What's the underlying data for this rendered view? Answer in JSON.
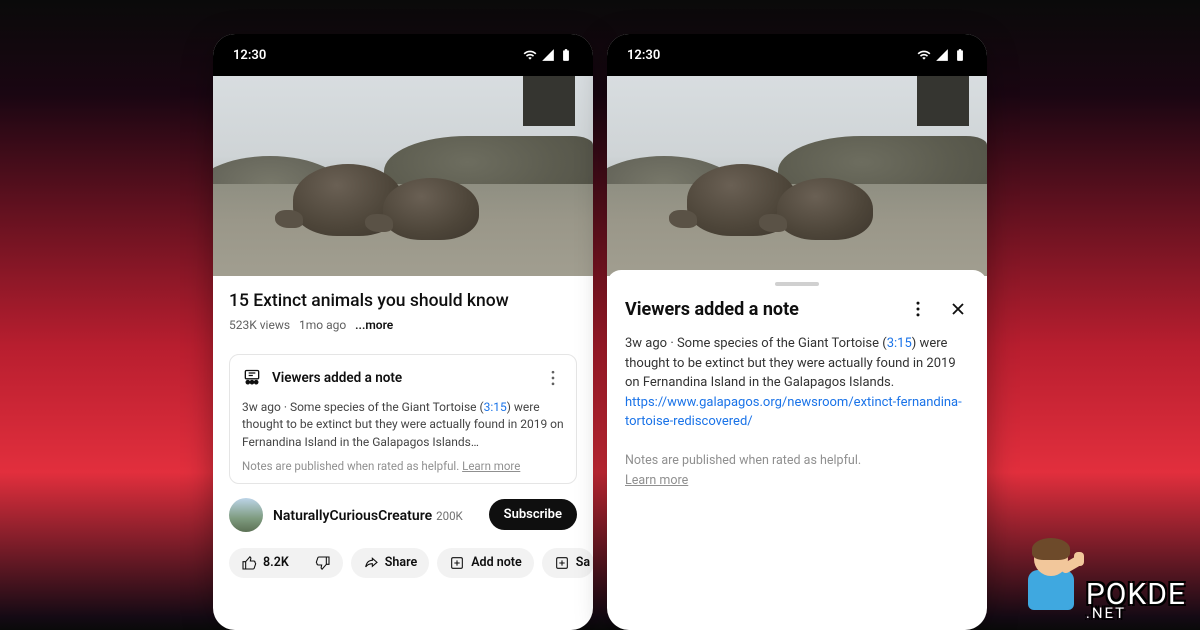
{
  "status": {
    "time": "12:30"
  },
  "video": {
    "title": "15 Extinct animals you should know",
    "views": "523K views",
    "age": "1mo ago",
    "more": "...more"
  },
  "note_card": {
    "heading": "Viewers added a note",
    "age": "3w ago",
    "text_prefix": " · Some species of the Giant Tortoise (",
    "timestamp": "3:15",
    "text_suffix": ") were thought to be extinct but they were actually found in 2019 on Fernandina Island in the Galapagos Islands…",
    "disclaimer": "Notes are published when rated as helpful. ",
    "learn_more": "Learn more"
  },
  "channel": {
    "name": "NaturallyCuriousCreature",
    "subs": "200K",
    "subscribe": "Subscribe"
  },
  "actions": {
    "likes": "8.2K",
    "share": "Share",
    "add_note": "Add note",
    "save": "Sa"
  },
  "sheet": {
    "title": "Viewers added a note",
    "age": "3w ago",
    "text_prefix": " · Some species of the Giant Tortoise (",
    "timestamp": "3:15",
    "text_suffix": ") were thought to be extinct but they were actually found in 2019 on Fernandina Island in the Galapagos Islands. ",
    "link": "https://www.galapagos.org/newsroom/extinct-fernandina-tortoise-rediscovered/",
    "disclaimer": "Notes are published when rated as helpful.",
    "learn_more": "Learn more"
  },
  "watermark": {
    "brand": "POKDE",
    "tld": ".NET"
  }
}
